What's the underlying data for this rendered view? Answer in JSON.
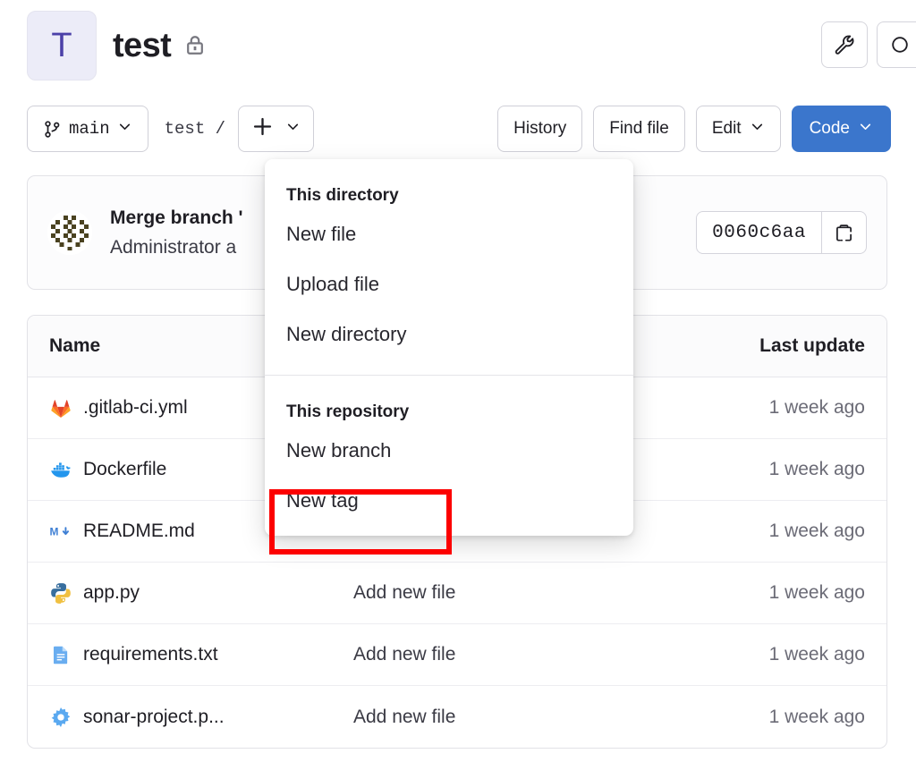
{
  "project": {
    "avatar_letter": "T",
    "name": "test",
    "visibility_icon": "lock-icon"
  },
  "header_actions": [
    {
      "name": "settings-wrench-button",
      "icon": "wrench-icon"
    },
    {
      "name": "secondary-action-button",
      "icon": "partial-icon"
    }
  ],
  "toolbar": {
    "branch_label": "main",
    "branch_icon": "branch-icon",
    "breadcrumb": "test /",
    "add_button_icon": "plus-icon",
    "history_label": "History",
    "find_file_label": "Find file",
    "edit_label": "Edit",
    "code_label": "Code",
    "code_color": "#3b76cc"
  },
  "commit": {
    "title": "Merge branch '",
    "author_line": "Administrator a",
    "sha": "0060c6aa",
    "copy_icon": "clipboard-icon"
  },
  "table": {
    "columns": {
      "name": "Name",
      "message": "",
      "last_update": "Last update"
    },
    "rows": [
      {
        "icon": "gitlab-icon",
        "name": ".gitlab-ci.yml",
        "message": "",
        "last_update": "1 week ago"
      },
      {
        "icon": "docker-icon",
        "name": "Dockerfile",
        "message": "",
        "last_update": "1 week ago"
      },
      {
        "icon": "markdown-icon",
        "name": "README.md",
        "message": "",
        "last_update": "1 week ago"
      },
      {
        "icon": "python-icon",
        "name": "app.py",
        "message": "Add new file",
        "last_update": "1 week ago"
      },
      {
        "icon": "document-icon",
        "name": "requirements.txt",
        "message": "Add new file",
        "last_update": "1 week ago"
      },
      {
        "icon": "gear-icon",
        "name": "sonar-project.p...",
        "message": "Add new file",
        "last_update": "1 week ago"
      }
    ]
  },
  "dropdown": {
    "section_directory_label": "This directory",
    "directory_items": [
      "New file",
      "Upload file",
      "New directory"
    ],
    "section_repository_label": "This repository",
    "repository_items": [
      "New branch",
      "New tag"
    ],
    "highlight_color": "#fc0000",
    "highlighted_item": "New tag"
  }
}
